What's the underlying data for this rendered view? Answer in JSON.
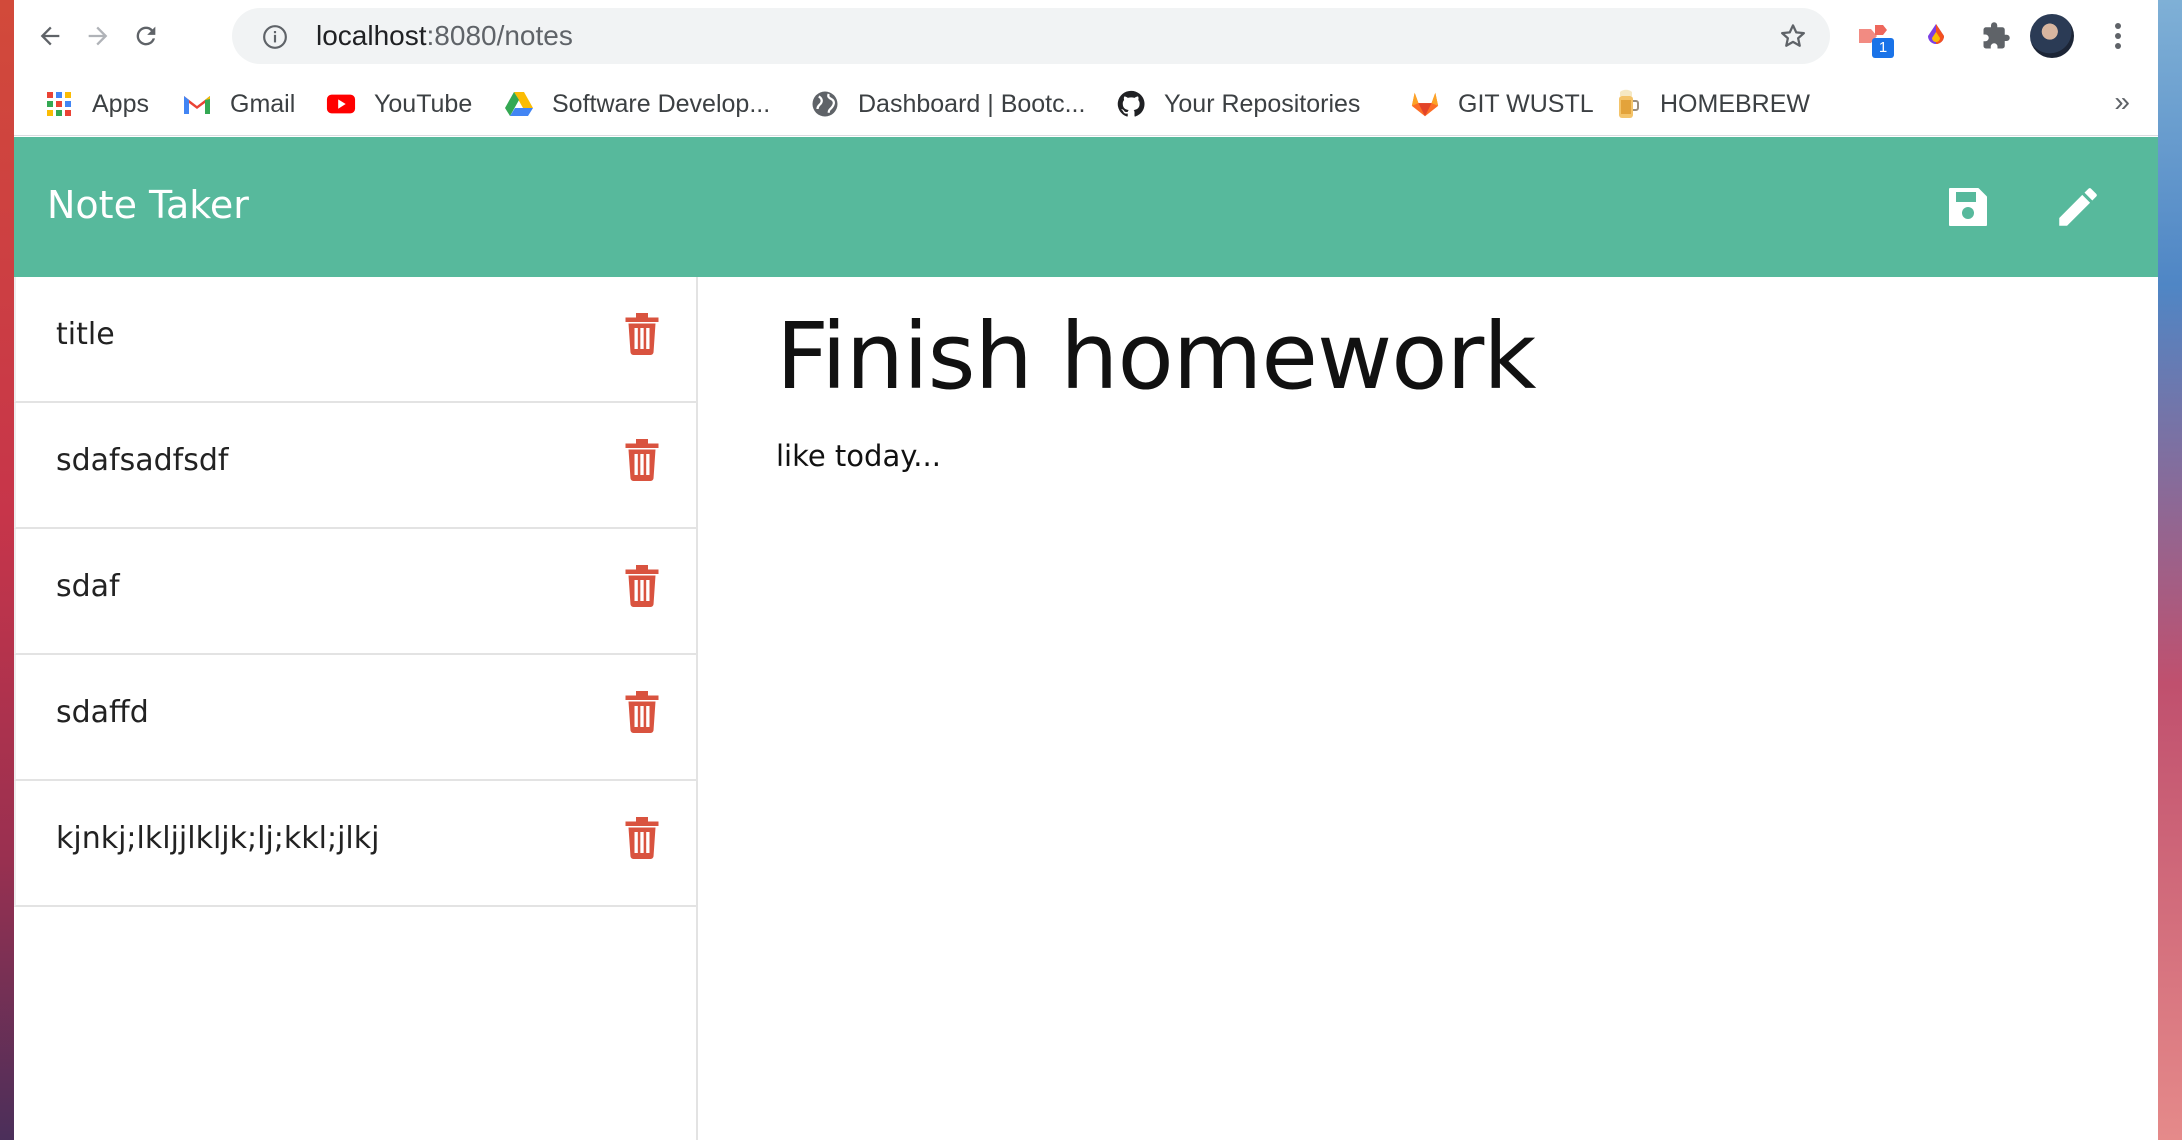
{
  "browser": {
    "url_host": "localhost",
    "url_path": ":8080/notes",
    "extension_badge": "1"
  },
  "bookmarks": [
    {
      "label": "Apps",
      "icon": "apps-grid-icon"
    },
    {
      "label": "Gmail",
      "icon": "gmail-icon"
    },
    {
      "label": "YouTube",
      "icon": "youtube-icon"
    },
    {
      "label": "Software Develop...",
      "icon": "google-drive-icon"
    },
    {
      "label": "Dashboard | Bootc...",
      "icon": "globe-icon"
    },
    {
      "label": "Your Repositories",
      "icon": "github-icon"
    },
    {
      "label": "GIT WUSTL",
      "icon": "gitlab-icon"
    },
    {
      "label": "HOMEBREW",
      "icon": "homebrew-icon"
    }
  ],
  "bookmarks_more": "»",
  "app": {
    "title": "Note Taker",
    "accent_color": "#57b99c",
    "delete_color": "#d9533f"
  },
  "notes": [
    {
      "title": "title"
    },
    {
      "title": "sdafsadfsdf"
    },
    {
      "title": "sdaf"
    },
    {
      "title": "sdaffd"
    },
    {
      "title": "kjnkj;lkljjlkljk;lj;kkl;jlkj"
    }
  ],
  "active_note": {
    "title": "Finish homework",
    "text": "like today..."
  }
}
